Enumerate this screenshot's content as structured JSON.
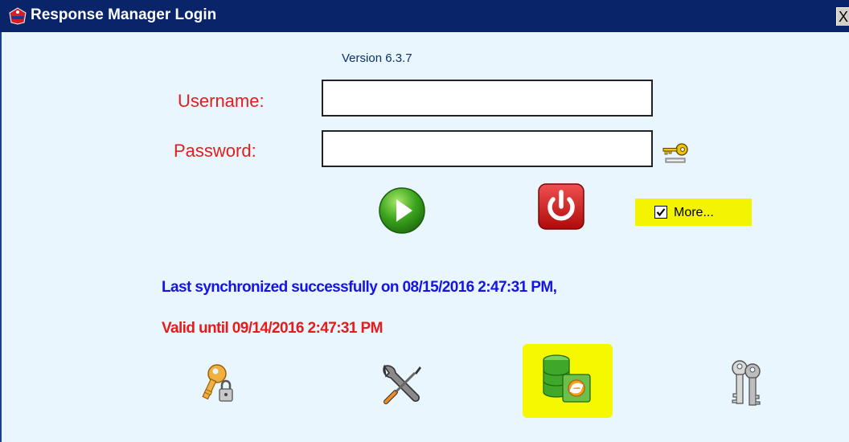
{
  "window": {
    "title": "Response Manager Login",
    "close_label": "X"
  },
  "version": "Version 6.3.7",
  "login": {
    "username_label": "Username:",
    "username_value": "",
    "password_label": "Password:",
    "password_value": ""
  },
  "more": {
    "label": "More...",
    "checked": true
  },
  "status": {
    "last_sync": "Last synchronized successfully on 08/15/2016 2:47:31 PM,",
    "valid_until": "Valid until 09/14/2016 2:47:31 PM"
  },
  "colors": {
    "label_red": "#e31d1d",
    "sync_blue": "#1414e8",
    "highlight": "#f4f300",
    "background": "#eaf6fd"
  },
  "icons": {
    "title": "app-logo-icon",
    "password_hint": "keys-icon",
    "login": "play-icon",
    "exit": "power-icon",
    "bottom": [
      "key-lock-icon",
      "wrench-screwdriver-icon",
      "database-sync-icon",
      "keys-icon"
    ]
  }
}
